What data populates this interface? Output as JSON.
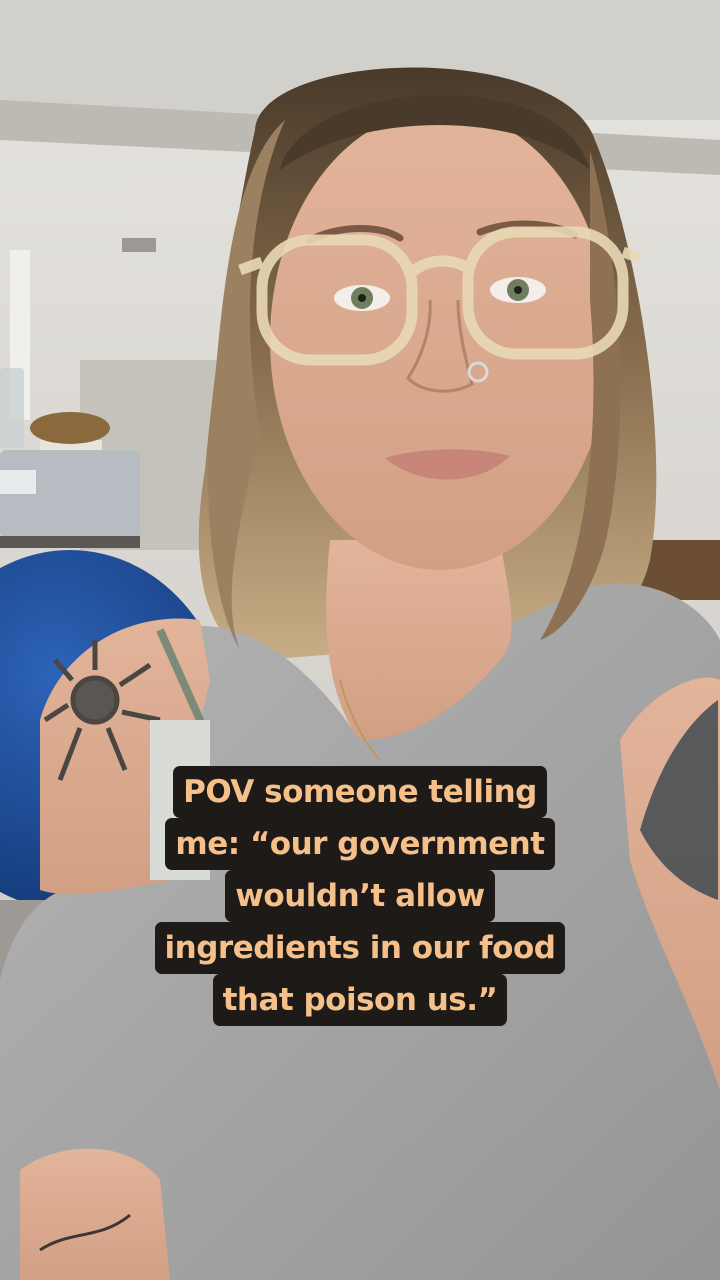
{
  "caption": {
    "lines": [
      "POV someone telling",
      "me: “our government",
      "wouldn’t allow",
      "ingredients in our food",
      "that poison us.”"
    ]
  },
  "colors": {
    "caption_text": "#f5c08a",
    "caption_background": "#1d1a17",
    "shirt": "#a9a9a9",
    "wall": "#d9d6d0",
    "exercise_ball": "#1f4f9c"
  }
}
